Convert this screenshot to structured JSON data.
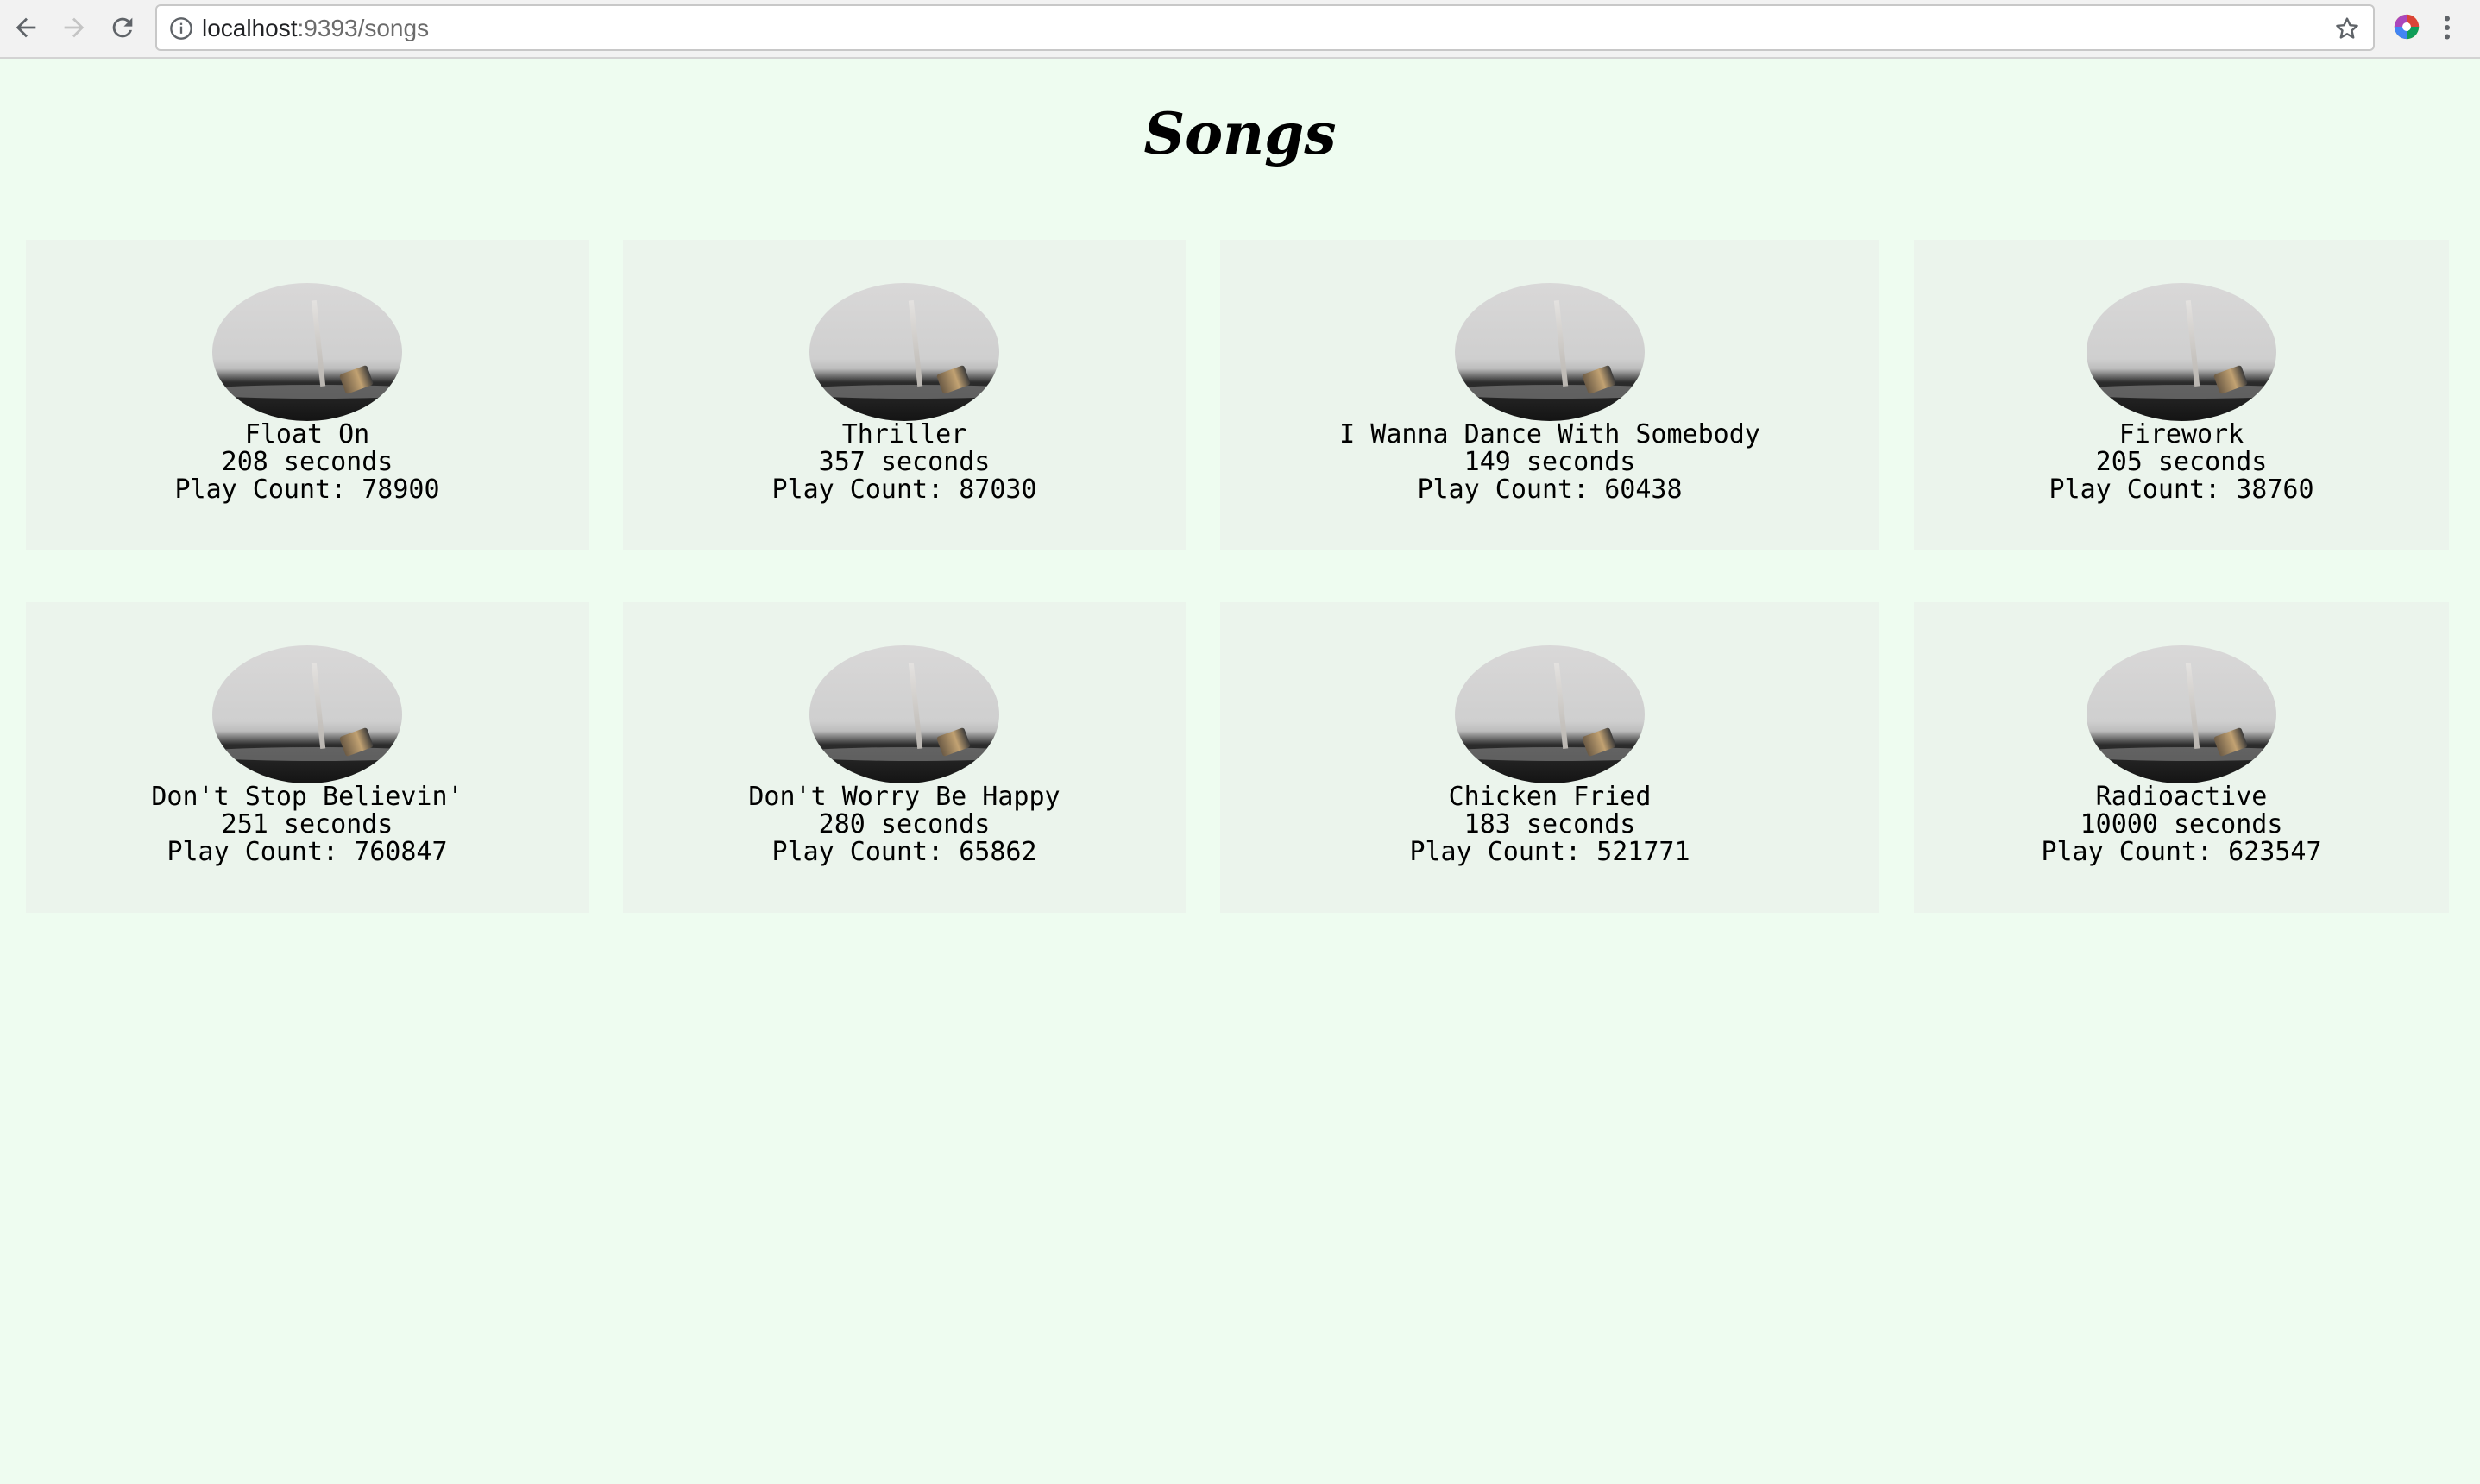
{
  "browser": {
    "url_host": "localhost",
    "url_rest": ":9393/songs"
  },
  "page": {
    "title": "Songs"
  },
  "songs": [
    {
      "title": "Float On",
      "duration": "208 seconds",
      "play_count": "Play Count: 78900"
    },
    {
      "title": "Thriller",
      "duration": "357 seconds",
      "play_count": "Play Count: 87030"
    },
    {
      "title": "I Wanna Dance With Somebody",
      "duration": "149 seconds",
      "play_count": "Play Count: 60438"
    },
    {
      "title": "Firework",
      "duration": "205 seconds",
      "play_count": "Play Count: 38760"
    },
    {
      "title": "Don't Stop Believin'",
      "duration": "251 seconds",
      "play_count": "Play Count: 760847"
    },
    {
      "title": "Don't Worry Be Happy",
      "duration": "280 seconds",
      "play_count": "Play Count: 65862"
    },
    {
      "title": "Chicken Fried",
      "duration": "183 seconds",
      "play_count": "Play Count: 521771"
    },
    {
      "title": "Radioactive",
      "duration": "10000 seconds",
      "play_count": "Play Count: 623547"
    }
  ]
}
